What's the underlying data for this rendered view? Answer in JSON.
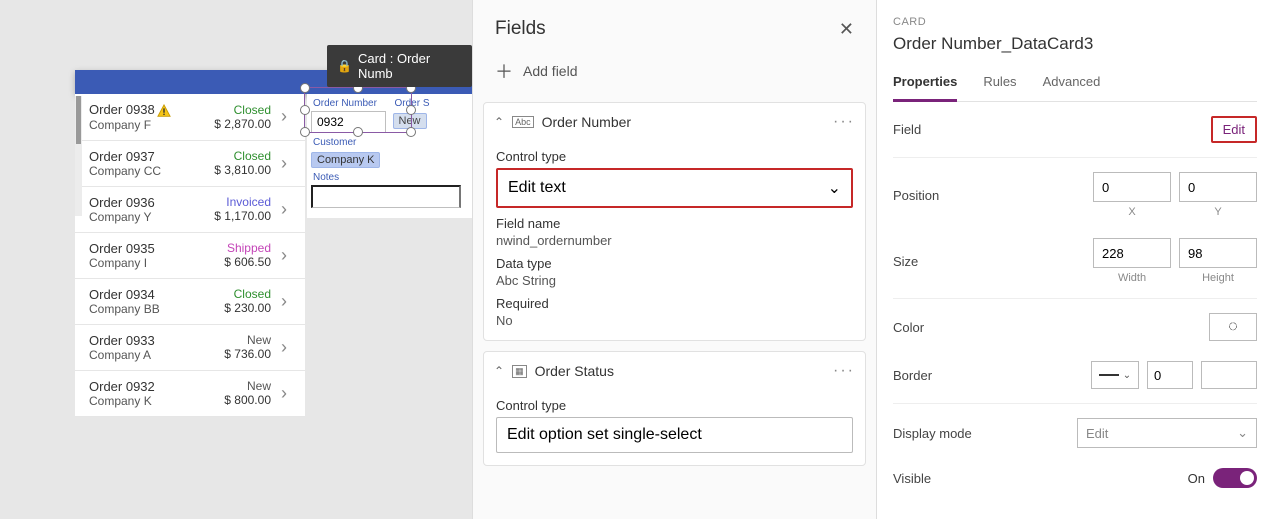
{
  "canvas": {
    "card_tooltip_prefix": "Card : ",
    "card_tooltip_name": "Order Numb",
    "orders": [
      {
        "no": "Order 0938",
        "warn": true,
        "company": "Company F",
        "status": "Closed",
        "status_cls": "closed",
        "price": "$ 2,870.00"
      },
      {
        "no": "Order 0937",
        "warn": false,
        "company": "Company CC",
        "status": "Closed",
        "status_cls": "closed",
        "price": "$ 3,810.00"
      },
      {
        "no": "Order 0936",
        "warn": false,
        "company": "Company Y",
        "status": "Invoiced",
        "status_cls": "invoiced",
        "price": "$ 1,170.00"
      },
      {
        "no": "Order 0935",
        "warn": false,
        "company": "Company I",
        "status": "Shipped",
        "status_cls": "shipped",
        "price": "$ 606.50"
      },
      {
        "no": "Order 0934",
        "warn": false,
        "company": "Company BB",
        "status": "Closed",
        "status_cls": "closed",
        "price": "$ 230.00"
      },
      {
        "no": "Order 0933",
        "warn": false,
        "company": "Company A",
        "status": "New",
        "status_cls": "new",
        "price": "$ 736.00"
      },
      {
        "no": "Order 0932",
        "warn": false,
        "company": "Company K",
        "status": "New",
        "status_cls": "new",
        "price": "$ 800.00"
      }
    ],
    "form": {
      "order_number_label": "Order Number",
      "order_number_value": "0932",
      "order_status_label": "Order S",
      "order_status_value": "New",
      "customer_label": "Customer",
      "customer_value": "Company K",
      "notes_label": "Notes",
      "notes_value": ""
    }
  },
  "fields": {
    "title": "Fields",
    "add_field": "Add field",
    "groups": [
      {
        "name": "Order Number",
        "icon": "Abc",
        "control_type_label": "Control type",
        "control_type": "Edit text",
        "field_name_label": "Field name",
        "field_name": "nwind_ordernumber",
        "data_type_label": "Data type",
        "data_type": "String",
        "required_label": "Required",
        "required": "No"
      },
      {
        "name": "Order Status",
        "icon": "grid",
        "control_type_label": "Control type",
        "control_type": "Edit option set single-select"
      }
    ]
  },
  "props": {
    "category": "CARD",
    "title": "Order Number_DataCard3",
    "tabs": {
      "properties": "Properties",
      "rules": "Rules",
      "advanced": "Advanced"
    },
    "field_label": "Field",
    "edit": "Edit",
    "position_label": "Position",
    "pos_x": "0",
    "pos_y": "0",
    "x_label": "X",
    "y_label": "Y",
    "size_label": "Size",
    "size_w": "228",
    "size_h": "98",
    "w_label": "Width",
    "h_label": "Height",
    "color_label": "Color",
    "border_label": "Border",
    "border_w": "0",
    "display_label": "Display mode",
    "display_val": "Edit",
    "visible_label": "Visible",
    "visible_on": "On"
  }
}
